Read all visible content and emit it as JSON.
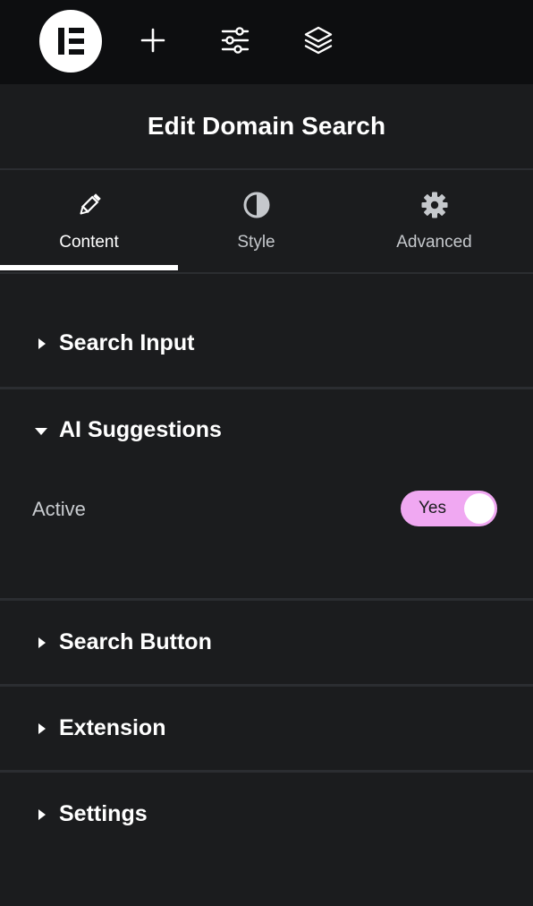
{
  "toolbar": {
    "logo": "elementor-logo",
    "icons": [
      "plus-icon",
      "sliders-icon",
      "layers-icon"
    ]
  },
  "panel": {
    "title": "Edit Domain Search"
  },
  "tabs": [
    {
      "label": "Content",
      "icon": "pencil-icon",
      "active": true
    },
    {
      "label": "Style",
      "icon": "half-circle-icon",
      "active": false
    },
    {
      "label": "Advanced",
      "icon": "gear-icon",
      "active": false
    }
  ],
  "sections": [
    {
      "title": "Search Input",
      "expanded": false
    },
    {
      "title": "AI Suggestions",
      "expanded": true,
      "controls": [
        {
          "label": "Active",
          "toggle_text": "Yes",
          "value": true
        }
      ]
    },
    {
      "title": "Search Button",
      "expanded": false
    },
    {
      "title": "Extension",
      "expanded": false
    },
    {
      "title": "Settings",
      "expanded": false
    }
  ],
  "colors": {
    "background": "#1b1c1e",
    "toolbar": "#0d0e10",
    "toggle_on": "#f0a8f2",
    "divider": "#2b2d31"
  }
}
